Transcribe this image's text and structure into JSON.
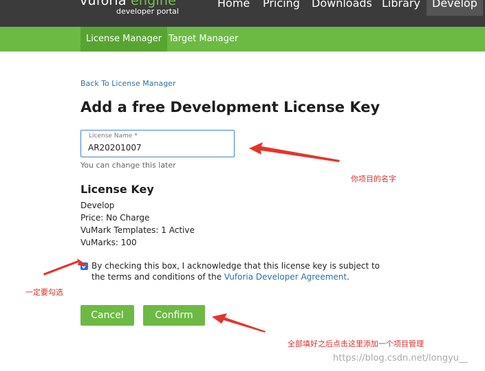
{
  "header": {
    "brand_prefix": "vuforia",
    "brand_suffix": "engine",
    "brand_sub": "developer portal",
    "nav": [
      "Home",
      "Pricing",
      "Downloads",
      "Library",
      "Develop"
    ],
    "active_nav": "Develop"
  },
  "subnav": {
    "tabs": [
      "License Manager",
      "Target Manager"
    ],
    "active": "License Manager"
  },
  "main": {
    "back_link": "Back To License Manager",
    "title": "Add a free Development License Key",
    "license_name_label": "License Name *",
    "license_name_value": "AR20201007",
    "helper": "You can change this later",
    "section_title": "License Key",
    "plan": "Develop",
    "price": "Price: No Charge",
    "vumark_templates": "VuMark Templates: 1 Active",
    "vumarks": "VuMarks: 100",
    "agreement_checked": true,
    "agreement_text_1": "By checking this box, I acknowledge that this license key is subject to the terms and conditions of the ",
    "agreement_link": "Vuforia Developer Agreement",
    "agreement_text_2": ".",
    "cancel_label": "Cancel",
    "confirm_label": "Confirm"
  },
  "annotations": {
    "name_note": "你项目的名字",
    "check_note": "一定要勾选",
    "confirm_note": "全部填好之后点击这里添加一个项目管理"
  },
  "watermark": "https://blog.csdn.net/longyu__",
  "colors": {
    "header_bg": "#3b3b3b",
    "brand_green": "#6cba43",
    "link_blue": "#2e6fa3",
    "annotation_red": "#d9302a"
  }
}
